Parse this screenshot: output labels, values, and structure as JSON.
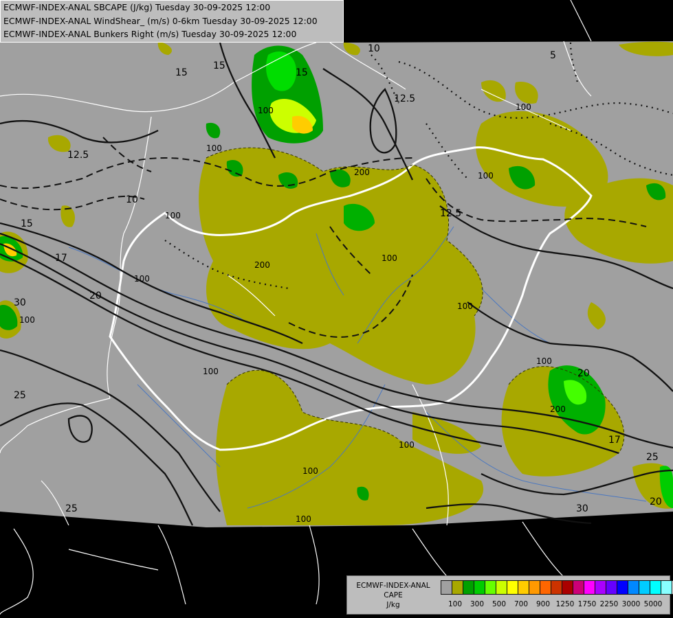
{
  "titles": [
    "ECMWF-INDEX-ANAL SBCAPE (J/kg) Tuesday 30-09-2025 12:00",
    "ECMWF-INDEX-ANAL WindShear_ (m/s) 0-6km Tuesday 30-09-2025 12:00",
    "ECMWF-INDEX-ANAL Bunkers Right (m/s) Tuesday 30-09-2025 12:00"
  ],
  "legend": {
    "line1": "ECMWF-INDEX-ANAL",
    "line2": "CAPE",
    "line3": "J/kg",
    "colors": [
      "#a0a0a0",
      "#a8a800",
      "#00a000",
      "#00cc00",
      "#66ff00",
      "#ccff00",
      "#ffff00",
      "#ffcc00",
      "#ff9900",
      "#ff6600",
      "#cc3300",
      "#aa0000",
      "#cc0077",
      "#ff00ff",
      "#aa00ff",
      "#6600ff",
      "#0000ff",
      "#0088ff",
      "#00ccff",
      "#00ffff",
      "#88ffff",
      "#ffffff"
    ],
    "ticks": [
      "100",
      "300",
      "500",
      "700",
      "900",
      "1250",
      "1750",
      "2250",
      "3000",
      "5000"
    ]
  },
  "contour_labels": {
    "shear": [
      "15",
      "15",
      "12.5",
      "10",
      "15",
      "17",
      "20",
      "25",
      "30",
      "25",
      "10",
      "5",
      "12.5",
      "12.5",
      "15",
      "20",
      "17",
      "25",
      "30",
      "20"
    ],
    "cape": [
      "100",
      "100",
      "100",
      "100",
      "100",
      "100",
      "100",
      "100",
      "100",
      "100",
      "100",
      "100",
      "200",
      "200",
      "200",
      "100",
      "100"
    ]
  },
  "colors": {
    "background": "#000000",
    "domain": "#a0a0a0",
    "cape_low": "#a8a800",
    "cape_mid": "#00a000",
    "border": "#ffffff",
    "river": "#4a77c0"
  }
}
